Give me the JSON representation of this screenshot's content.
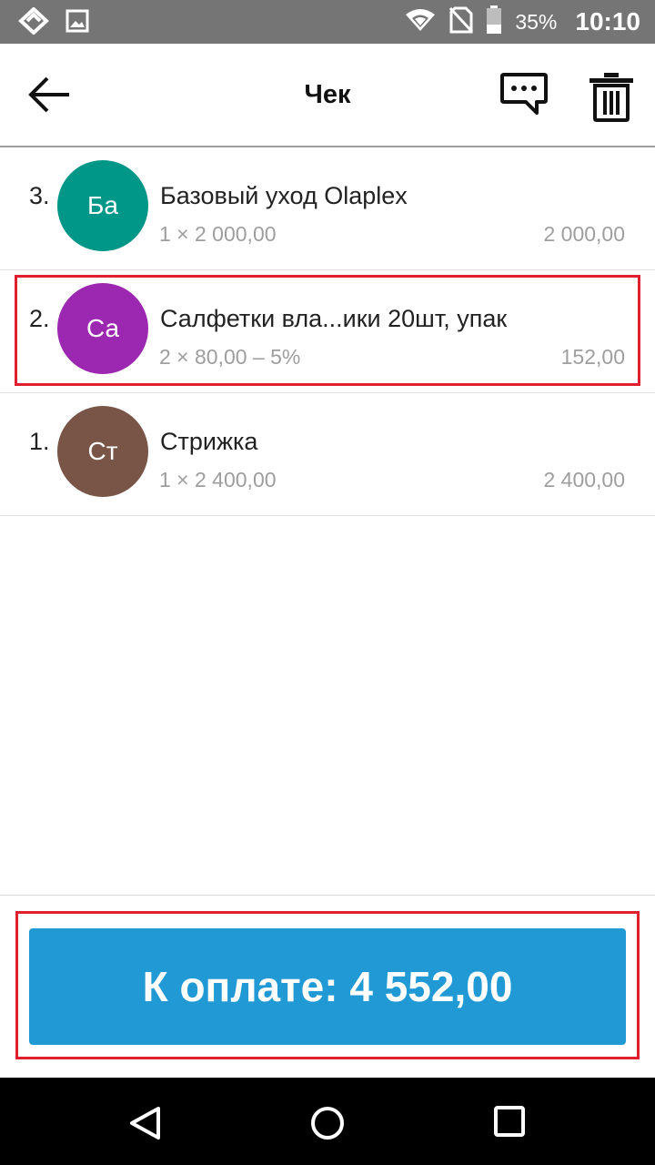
{
  "status_bar": {
    "battery_percent": "35%",
    "time": "10:10"
  },
  "header": {
    "title": "Чек"
  },
  "items": [
    {
      "number": "3.",
      "avatar": "Ба",
      "avatar_color": "#009688",
      "name": "Базовый уход Olaplex",
      "quantity": "1 × 2 000,00",
      "amount": "2 000,00"
    },
    {
      "number": "2.",
      "avatar": "Са",
      "avatar_color": "#9c27b0",
      "name": "Салфетки вла...ики 20шт, упак",
      "quantity": "2 × 80,00 – 5%",
      "amount": "152,00"
    },
    {
      "number": "1.",
      "avatar": "Ст",
      "avatar_color": "#795548",
      "name": "Стрижка",
      "quantity": "1 × 2 400,00",
      "amount": "2 400,00"
    }
  ],
  "pay_button": {
    "label": "К оплате: 4 552,00"
  },
  "colors": {
    "accent": "#2199d5",
    "highlight": "#e0202f"
  }
}
